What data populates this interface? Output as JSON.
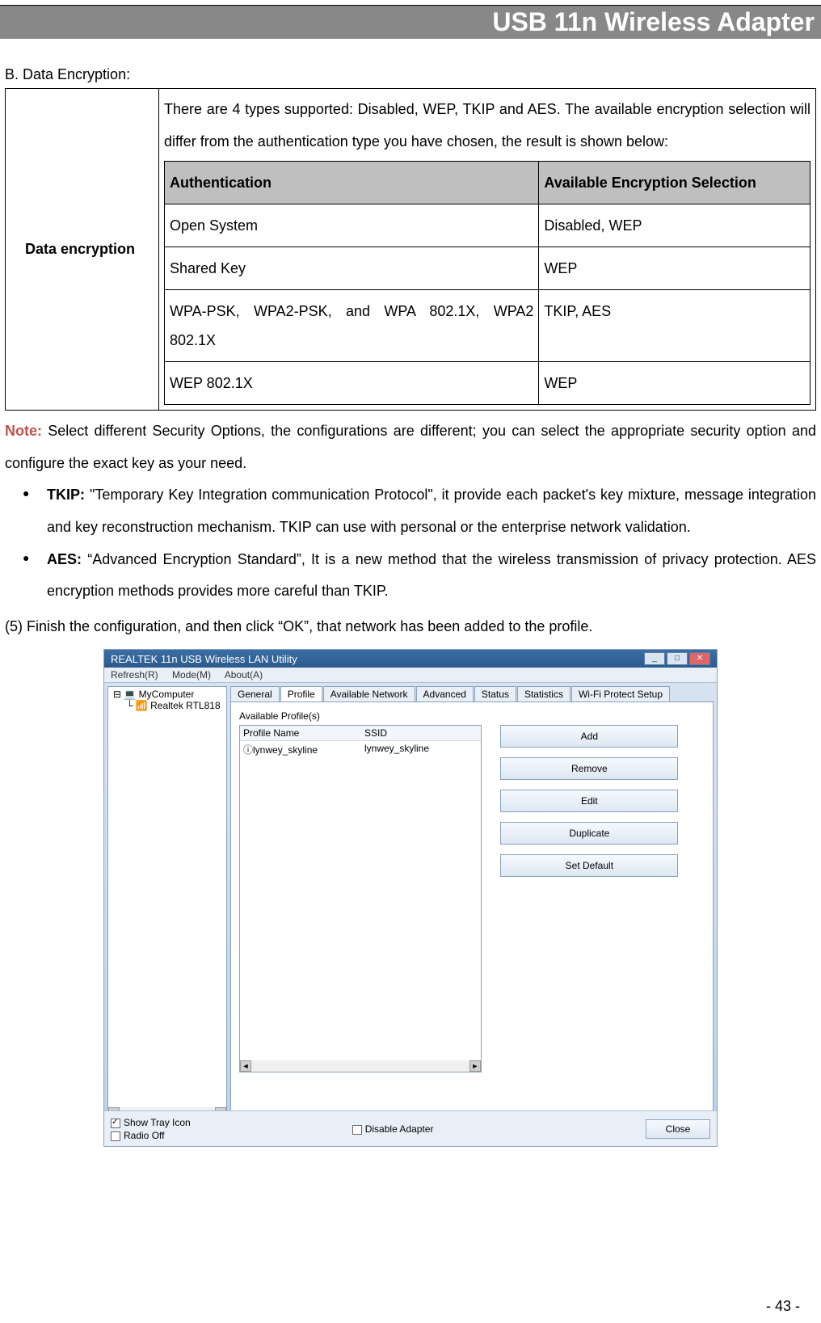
{
  "header_title": "USB 11n Wireless Adapter",
  "section_b_heading": "B. Data Encryption:",
  "outer_left_label": "Data encryption",
  "intro_text": "There are 4 types supported: Disabled, WEP, TKIP and AES. The available encryption selection will differ from the authentication type you have chosen, the result is shown below:",
  "inner_table": {
    "header_auth": "Authentication",
    "header_avail": "Available Encryption Selection",
    "rows": [
      {
        "auth": "Open System",
        "avail": "Disabled, WEP"
      },
      {
        "auth": "Shared Key",
        "avail": "WEP"
      },
      {
        "auth": "WPA-PSK, WPA2-PSK, and WPA 802.1X, WPA2 802.1X",
        "avail": "TKIP, AES"
      },
      {
        "auth": "WEP 802.1X",
        "avail": "WEP"
      }
    ]
  },
  "note_label": "Note:",
  "note_text": " Select different Security Options, the configurations are different; you can select the appropriate security option and configure the exact key as your need.",
  "bullets": [
    {
      "label": "TKIP:",
      "text": " \"Temporary Key Integration communication Protocol\", it provide each packet's key mixture, message integration and key reconstruction mechanism. TKIP can use with personal or the enterprise network validation."
    },
    {
      "label": "AES:",
      "text": " “Advanced Encryption Standard”, It is a new method that the wireless transmission of privacy protection. AES encryption methods provides more careful than TKIP."
    }
  ],
  "step_text": "(5) Finish the configuration, and then click “OK”, that network has been added to the profile.",
  "screenshot": {
    "window_title": "REALTEK 11n USB Wireless LAN Utility",
    "menu": [
      "Refresh(R)",
      "Mode(M)",
      "About(A)"
    ],
    "tree": {
      "root": "MyComputer",
      "child": "Realtek RTL818"
    },
    "tabs": [
      "General",
      "Profile",
      "Available Network",
      "Advanced",
      "Status",
      "Statistics",
      "Wi-Fi Protect Setup"
    ],
    "active_tab_index": 1,
    "profiles_label": "Available Profile(s)",
    "profile_cols": [
      "Profile Name",
      "SSID"
    ],
    "profile_rows": [
      {
        "name": "lynwey_skyline",
        "ssid": "lynwey_skyline"
      }
    ],
    "buttons": [
      "Add",
      "Remove",
      "Edit",
      "Duplicate",
      "Set Default"
    ],
    "status": {
      "show_tray": "Show Tray Icon",
      "radio_off": "Radio Off",
      "disable_adapter": "Disable Adapter",
      "close": "Close"
    }
  },
  "page_number": "- 43 -"
}
